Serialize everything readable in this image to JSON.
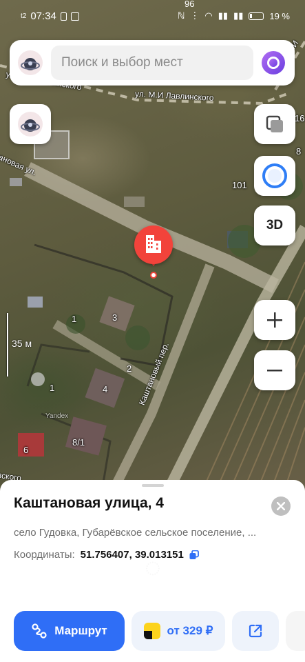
{
  "status_bar": {
    "time": "07:34",
    "left_tag": "t2",
    "top_number": "96",
    "battery_percent": "19 %"
  },
  "search": {
    "placeholder": "Поиск и выбор мест"
  },
  "map": {
    "street_labels": [
      "ул М.И Лавлинского",
      "ул. М.И Лавлинского",
      "ул. М.И",
      "ановая ул.",
      "Каштановый пер.",
      "вского"
    ],
    "house_numbers": [
      "101",
      "16",
      "8",
      "1",
      "3",
      "2",
      "1",
      "4",
      "8/1",
      "6"
    ],
    "scale": "35 м",
    "yandex_mark": "Yandex",
    "threed_label": "3D"
  },
  "place": {
    "title": "Каштановая улица, 4",
    "address": "село Гудовка, Губарёвское сельское поселение, ...",
    "coordinates_label": "Координаты:",
    "coordinates_value": "51.756407, 39.013151"
  },
  "actions": {
    "route_label": "Маршрут",
    "taxi_label": "от 329 ₽"
  },
  "colors": {
    "accent": "#2f6ef6",
    "pin": "#f2433b",
    "taxi_yellow": "#fcd31c"
  }
}
